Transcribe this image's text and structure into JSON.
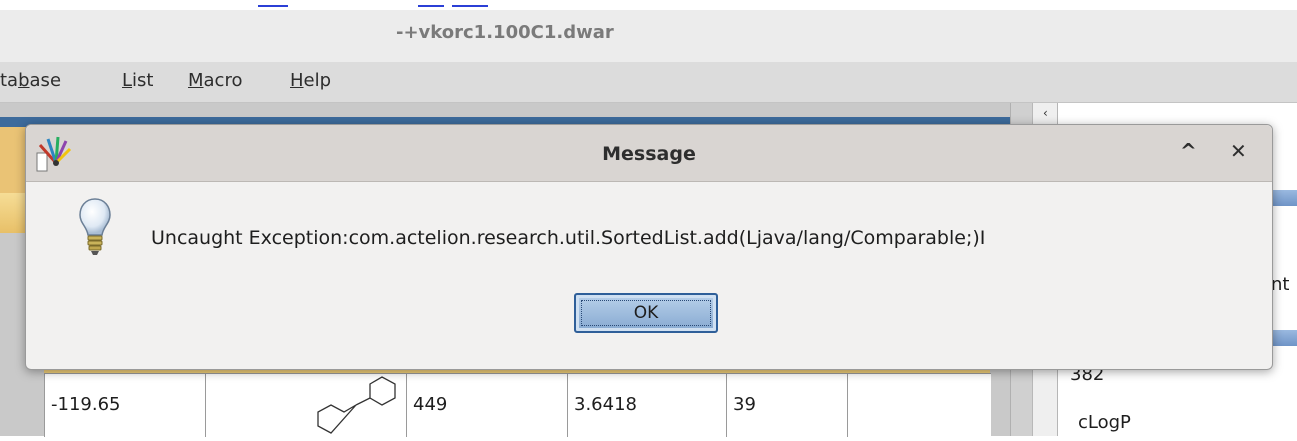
{
  "window": {
    "title": "-+vkorc1.100C1.dwar"
  },
  "menubar": {
    "items": [
      {
        "pre": "ta",
        "key": "b",
        "post": "ase"
      },
      {
        "pre": "",
        "key": "L",
        "post": "ist"
      },
      {
        "pre": "",
        "key": "M",
        "post": "acro"
      },
      {
        "pre": "",
        "key": "H",
        "post": "elp"
      }
    ]
  },
  "table": {
    "row": [
      "-119.65",
      "",
      "449",
      "3.6418",
      "39"
    ]
  },
  "right_panel": {
    "partial_text": "nt",
    "value": "382",
    "label": "cLogP"
  },
  "dialog": {
    "title": "Message",
    "message": "Uncaught Exception:com.actelion.research.util.SortedList.add(Ljava/lang/Comparable;)I",
    "ok_label": "OK",
    "minimize_glyph": "^",
    "close_glyph": "✕"
  },
  "icons": {
    "app": "app-logo-icon",
    "info": "lightbulb-icon"
  },
  "colors": {
    "button_blue": "#86a9d1",
    "table_header": "#f1cf7a",
    "link_blue": "#2b3fd6"
  }
}
